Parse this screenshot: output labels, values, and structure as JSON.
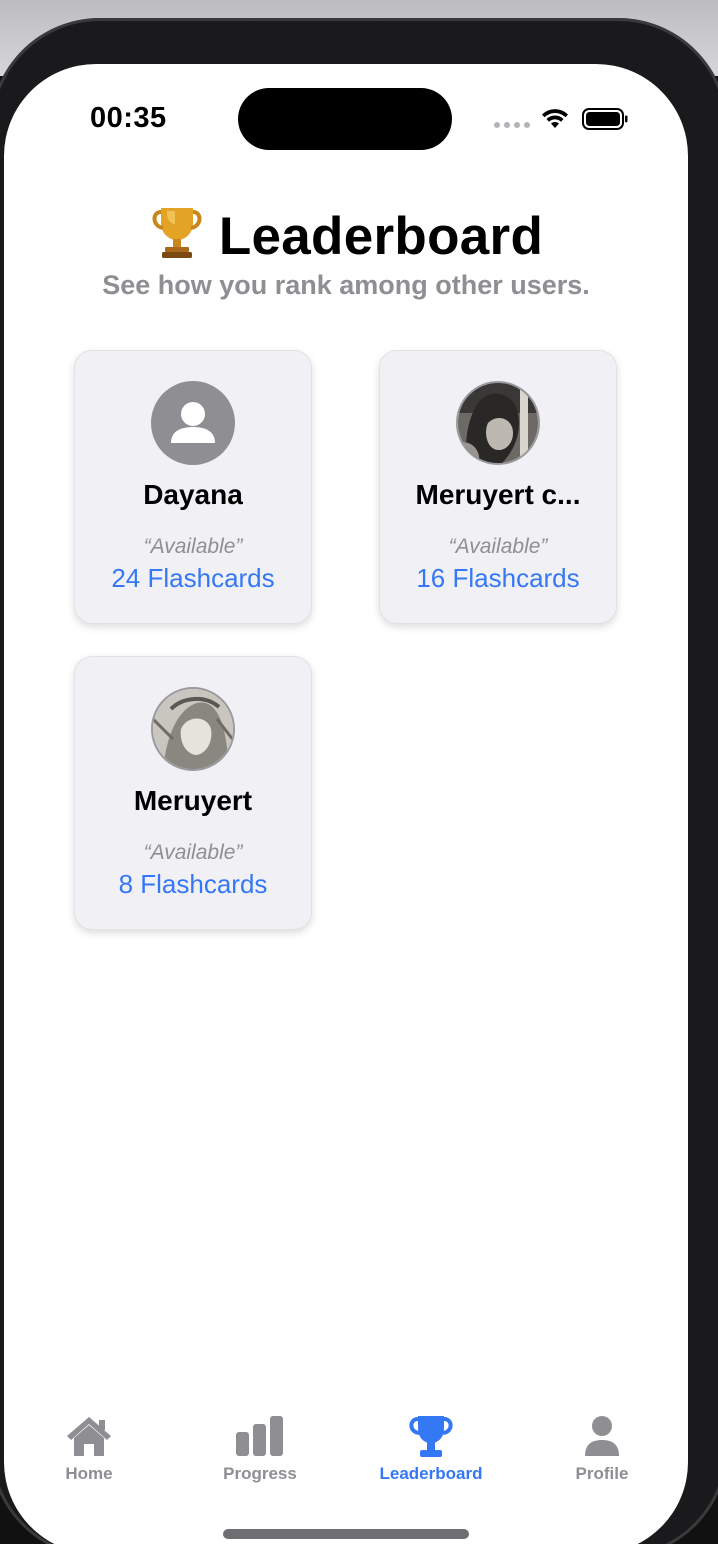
{
  "status_bar": {
    "time": "00:35"
  },
  "header": {
    "title": "Leaderboard",
    "subtitle": "See how you rank among other users."
  },
  "users": [
    {
      "name": "Dayana",
      "status": "“Available”",
      "flashcards": "24 Flashcards",
      "avatar": "default-person"
    },
    {
      "name": "Meruyert c...",
      "status": "“Available”",
      "flashcards": "16 Flashcards",
      "avatar": "photo"
    },
    {
      "name": "Meruyert",
      "status": "“Available”",
      "flashcards": "8 Flashcards",
      "avatar": "photo"
    }
  ],
  "tabs": [
    {
      "label": "Home",
      "icon": "house-icon",
      "active": false
    },
    {
      "label": "Progress",
      "icon": "bar-chart-icon",
      "active": false
    },
    {
      "label": "Leaderboard",
      "icon": "trophy-icon",
      "active": true
    },
    {
      "label": "Profile",
      "icon": "person-icon",
      "active": false
    }
  ],
  "colors": {
    "accent": "#3478f6",
    "secondary_text": "#8e8e93",
    "card_background": "#f1f1f5"
  }
}
